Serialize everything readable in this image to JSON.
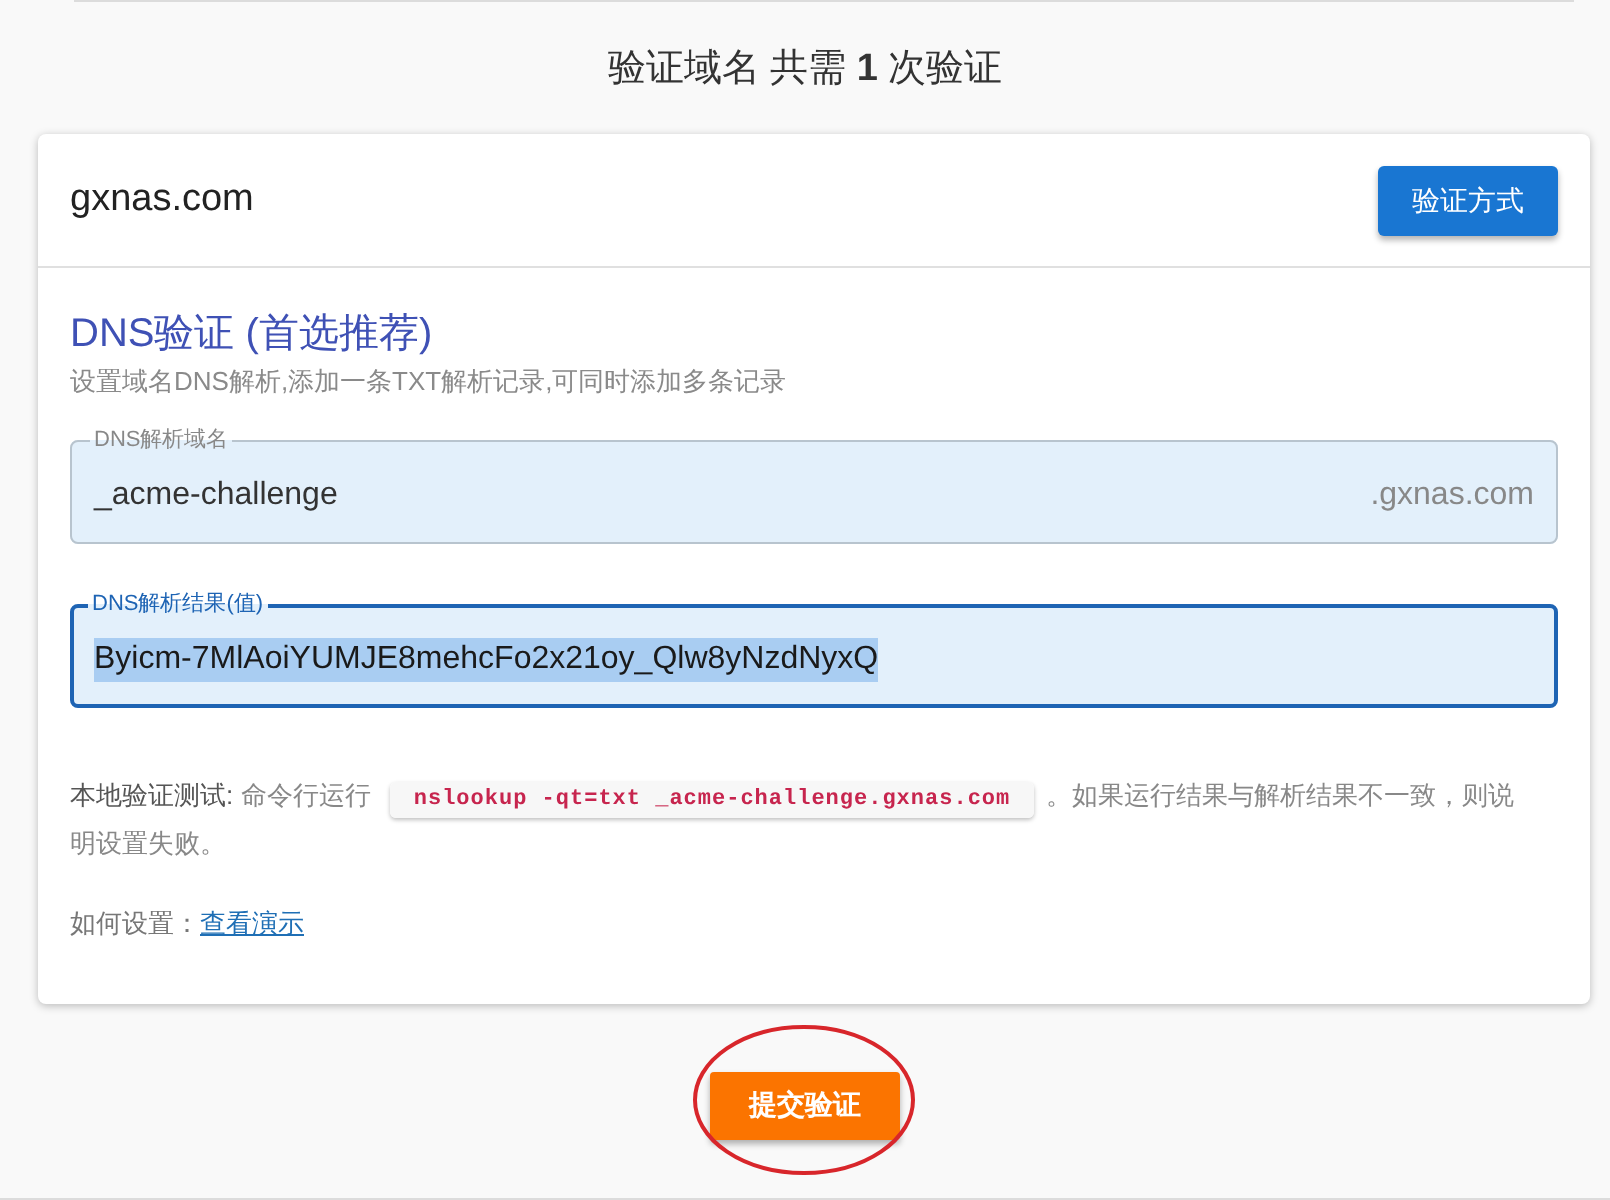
{
  "heading": "验证域名 共需 **1** 次验证",
  "card": {
    "domain": "gxnas.com",
    "method_button": "验证方式"
  },
  "dns": {
    "title": "DNS验证 (首选推荐)",
    "description": "设置域名DNS解析,添加一条TXT解析记录,可同时添加多条记录",
    "fields": [
      {
        "label": "DNS解析域名",
        "value": "_acme-challenge",
        "suffix": ".gxnas.com",
        "focused": false,
        "value_selected": false
      },
      {
        "label": "DNS解析结果(值)",
        "value": "Byicm-7MlAoiYUMJE8mehcFo2x21oy_Qlw8yNzdNyxQ",
        "focused": true,
        "value_selected": true
      }
    ],
    "local_test": {
      "label": "本地验证测试:",
      "text_before": "命令行运行",
      "command": "nslookup -qt=txt _acme-challenge.gxnas.com",
      "text_after": "。如果运行结果与解析结果不一致，则说明设置失败。"
    },
    "how_to": {
      "label": "如何设置：",
      "link": "查看演示"
    }
  },
  "submit_button": "提交验证"
}
